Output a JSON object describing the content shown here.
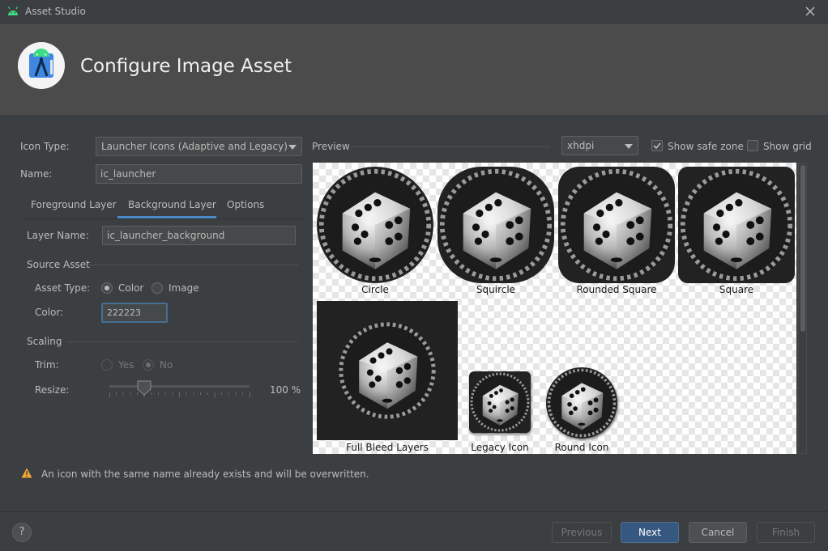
{
  "window": {
    "title": "Asset Studio"
  },
  "header": {
    "heading": "Configure Image Asset"
  },
  "form": {
    "icon_type_label": "Icon Type:",
    "icon_type_value": "Launcher Icons (Adaptive and Legacy)",
    "name_label": "Name:",
    "name_value": "ic_launcher"
  },
  "tabs": [
    {
      "label": "Foreground Layer"
    },
    {
      "label": "Background Layer",
      "selected": true
    },
    {
      "label": "Options"
    }
  ],
  "layer": {
    "layer_name_label": "Layer Name:",
    "layer_name_value": "ic_launcher_background",
    "source_asset_heading": "Source Asset",
    "asset_type_label": "Asset Type:",
    "asset_type_options": [
      "Color",
      "Image"
    ],
    "asset_type_selected": "Color",
    "color_label": "Color:",
    "color_value": "222223",
    "scaling_heading": "Scaling",
    "trim_label": "Trim:",
    "trim_options": [
      "Yes",
      "No"
    ],
    "trim_selected": "No",
    "resize_label": "Resize:",
    "resize_value": "100 %",
    "resize_percent": 100
  },
  "preview": {
    "label": "Preview",
    "density_value": "xhdpi",
    "show_safe_zone_label": "Show safe zone",
    "show_safe_zone_checked": true,
    "show_grid_label": "Show grid",
    "show_grid_checked": false,
    "icons": [
      {
        "caption": "Circle"
      },
      {
        "caption": "Squircle"
      },
      {
        "caption": "Rounded Square"
      },
      {
        "caption": "Square"
      },
      {
        "caption": "Full Bleed Layers"
      },
      {
        "caption": "Legacy Icon"
      },
      {
        "caption": "Round Icon"
      }
    ]
  },
  "warning": {
    "text": "An icon with the same name already exists and will be overwritten."
  },
  "footer": {
    "help_label": "?",
    "previous_label": "Previous",
    "next_label": "Next",
    "cancel_label": "Cancel",
    "finish_label": "Finish"
  },
  "colors": {
    "background": "#3c3f41",
    "banner": "#4b4b4b",
    "accent": "#4a88c7",
    "primary_button": "#365880",
    "icon_background": "#222223",
    "warning": "#f0a732"
  }
}
